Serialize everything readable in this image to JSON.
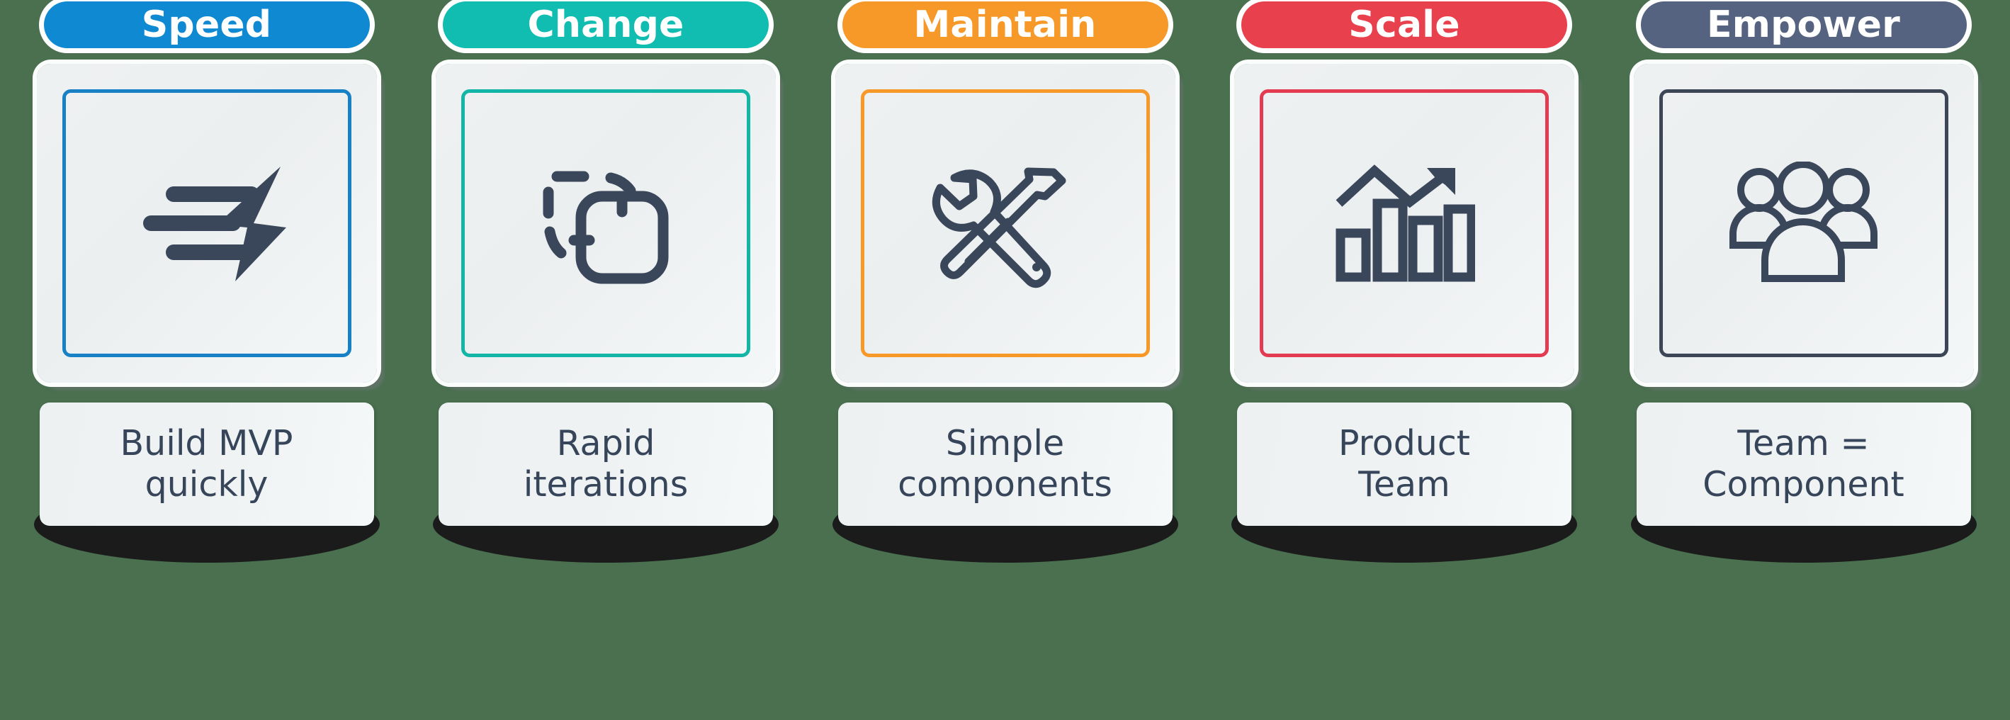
{
  "background_color": "#4a7050",
  "ink_color": "#37455a",
  "columns": [
    {
      "id": "speed",
      "header": "Speed",
      "header_color": "#1089d3",
      "accent_color": "#1880c4",
      "icon": "speed-lines-bolt-icon",
      "caption_line1": "Build MVP",
      "caption_line2": "quickly"
    },
    {
      "id": "change",
      "header": "Change",
      "header_color": "#10bdb0",
      "accent_color": "#13b5a6",
      "icon": "dashed-square-transform-icon",
      "caption_line1": "Rapid",
      "caption_line2": "iterations"
    },
    {
      "id": "maintain",
      "header": "Maintain",
      "header_color": "#f69929",
      "accent_color": "#f69929",
      "icon": "wrench-screwdriver-icon",
      "caption_line1": "Simple",
      "caption_line2": "components"
    },
    {
      "id": "scale",
      "header": "Scale",
      "header_color": "#e8404c",
      "accent_color": "#e33b52",
      "icon": "bar-chart-growth-icon",
      "caption_line1": "Product",
      "caption_line2": "Team"
    },
    {
      "id": "empower",
      "header": "Empower",
      "header_color": "#566380",
      "accent_color": "#3c4657",
      "icon": "users-group-icon",
      "caption_line1": "Team =",
      "caption_line2": "Component"
    }
  ]
}
